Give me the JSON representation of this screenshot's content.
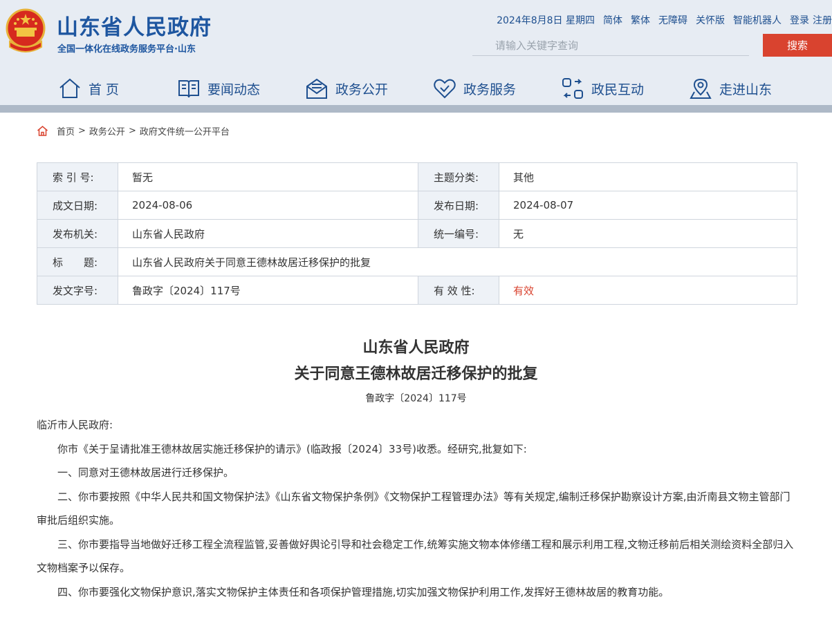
{
  "header": {
    "title": "山东省人民政府",
    "subtitle": "全国一体化在线政务服务平台·山东",
    "emblem_icon": "national-emblem-icon",
    "date": "2024年8月8日 星期四",
    "links": {
      "simplified": "简体",
      "traditional": "繁体",
      "accessible": "无障碍",
      "elderly": "关怀版",
      "robot": "智能机器人",
      "login": "登录",
      "register": "注册"
    },
    "search": {
      "placeholder": "请输入关键字查询",
      "value": "",
      "button_label": "搜索"
    }
  },
  "nav": [
    {
      "label": "首 页",
      "icon": "home-icon"
    },
    {
      "label": "要闻动态",
      "icon": "book-icon"
    },
    {
      "label": "政务公开",
      "icon": "mail-icon"
    },
    {
      "label": "政务服务",
      "icon": "heart-icon"
    },
    {
      "label": "政民互动",
      "icon": "interaction-icon"
    },
    {
      "label": "走进山东",
      "icon": "map-pin-icon"
    }
  ],
  "breadcrumb": {
    "icon": "home-icon",
    "items": [
      "首页",
      "政务公开",
      "政府文件统一公开平台"
    ],
    "separator": ">"
  },
  "meta": {
    "index_label": "索 引 号:",
    "index_value": "暂无",
    "topic_label": "主题分类:",
    "topic_value": "其他",
    "written_label": "成文日期:",
    "written_value": "2024-08-06",
    "published_label": "发布日期:",
    "published_value": "2024-08-07",
    "issuer_label": "发布机关:",
    "issuer_value": "山东省人民政府",
    "code_label": "统一编号:",
    "code_value": "无",
    "title_label": "标　　题:",
    "title_value": "山东省人民政府关于同意王德林故居迁移保护的批复",
    "docno_label": "发文字号:",
    "docno_value": "鲁政字〔2024〕117号",
    "validity_label": "有 效 性:",
    "validity_value": "有效",
    "validity_color": "#d9432f"
  },
  "document": {
    "title_line1": "山东省人民政府",
    "title_line2": "关于同意王德林故居迁移保护的批复",
    "doc_no": "鲁政字〔2024〕117号",
    "recipient": "临沂市人民政府:",
    "paragraphs": [
      "你市《关于呈请批准王德林故居实施迁移保护的请示》(临政报〔2024〕33号)收悉。经研究,批复如下:",
      "一、同意对王德林故居进行迁移保护。",
      "二、你市要按照《中华人民共和国文物保护法》《山东省文物保护条例》《文物保护工程管理办法》等有关规定,编制迁移保护勘察设计方案,由沂南县文物主管部门审批后组织实施。",
      "三、你市要指导当地做好迁移工程全流程监管,妥善做好舆论引导和社会稳定工作,统筹实施文物本体修缮工程和展示利用工程,文物迁移前后相关测绘资料全部归入文物档案予以保存。",
      "四、你市要强化文物保护意识,落实文物保护主体责任和各项保护管理措施,切实加强文物保护利用工作,发挥好王德林故居的教育功能。"
    ]
  },
  "colors": {
    "brand_blue": "#1e56a0",
    "accent_red": "#d9432f",
    "header_bg": "#e7ecf3"
  }
}
